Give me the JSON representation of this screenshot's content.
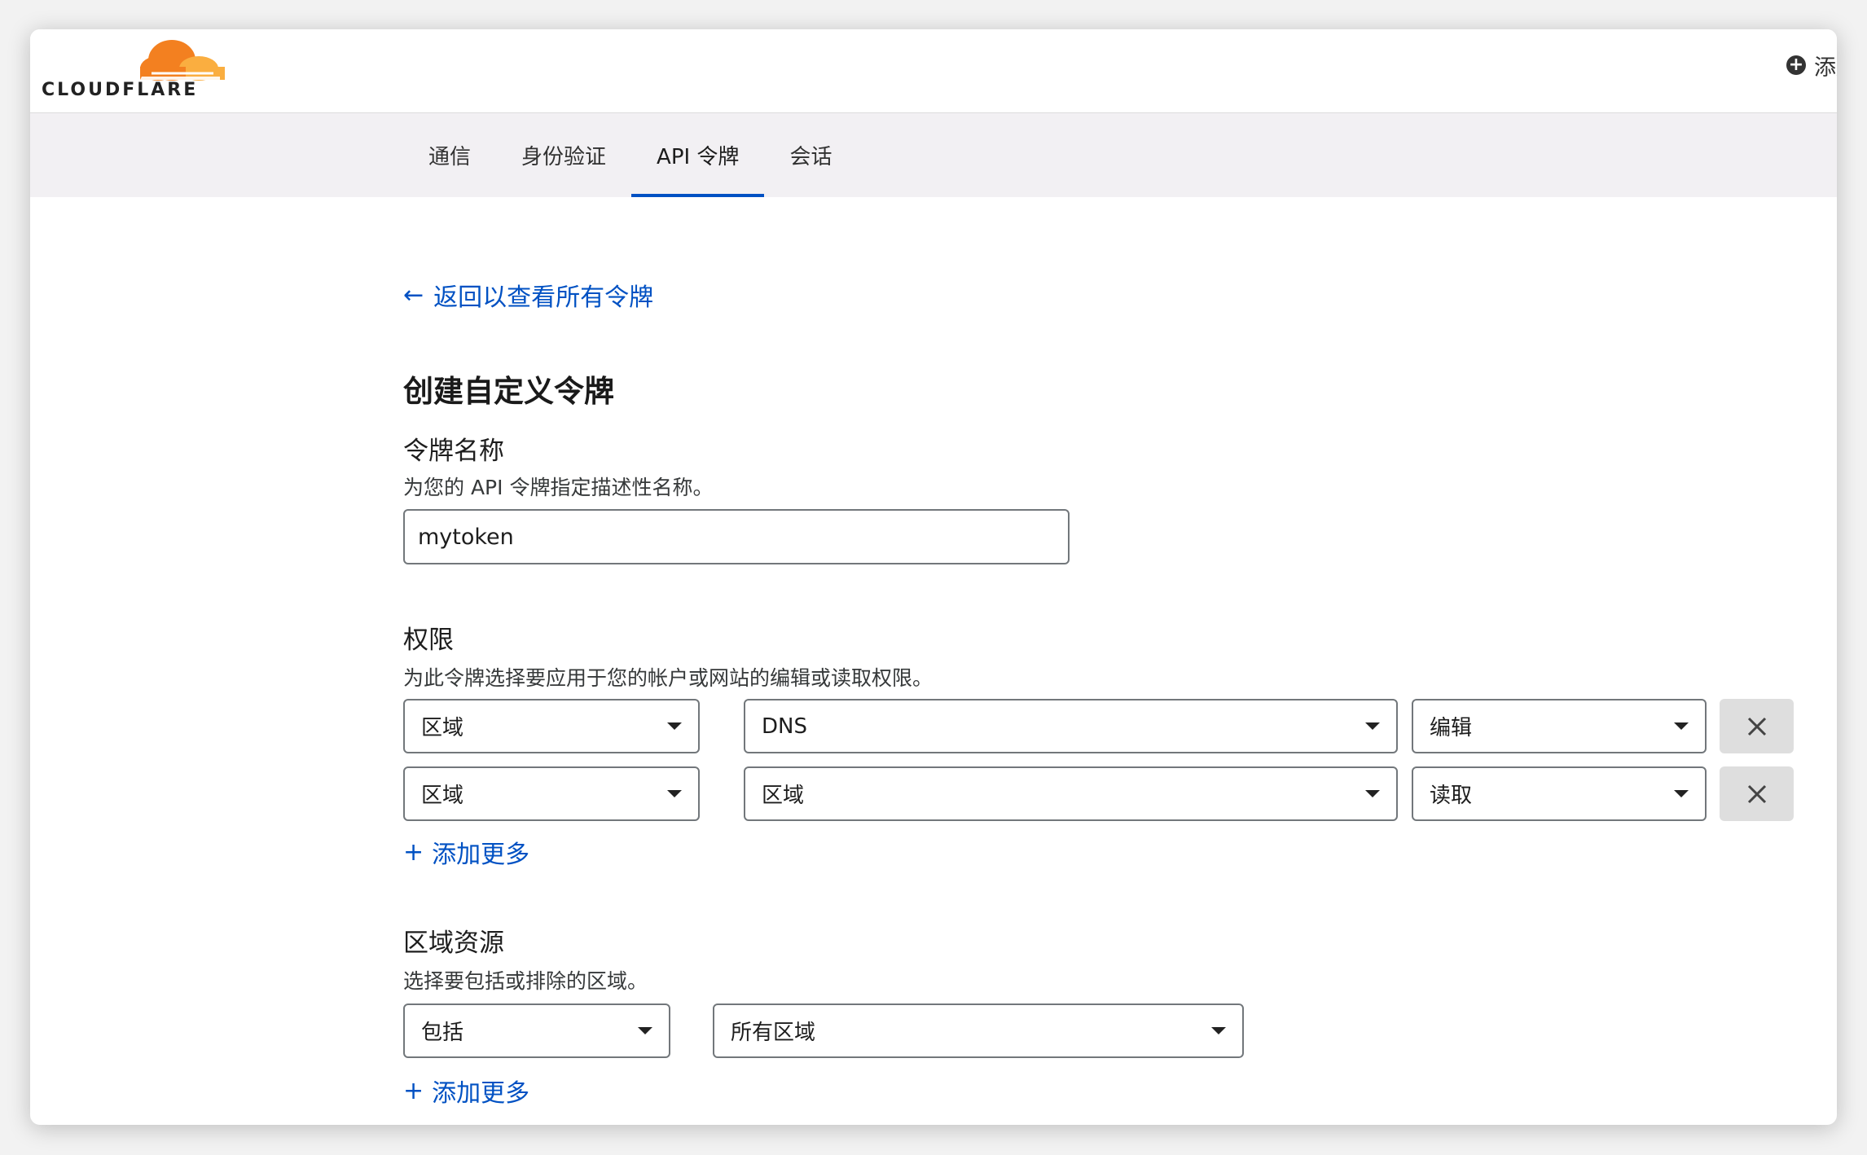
{
  "brand": {
    "logo_text": "CLOUDFLARE",
    "orange": "#f38020",
    "orange_light": "#faae40"
  },
  "header": {
    "add_label": "添加站点",
    "add_icon": "plus-circle-icon"
  },
  "nav": {
    "tabs": [
      {
        "label": "通信",
        "active": false
      },
      {
        "label": "身份验证",
        "active": false
      },
      {
        "label": "API 令牌",
        "active": true
      },
      {
        "label": "会话",
        "active": false
      }
    ],
    "active_color": "#0051c3"
  },
  "page": {
    "back_label": "返回以查看所有令牌",
    "title": "创建自定义令牌",
    "link_color": "#0051c3"
  },
  "token_name": {
    "label": "令牌名称",
    "description": "为您的 API 令牌指定描述性名称。",
    "value": "mytoken"
  },
  "permissions": {
    "label": "权限",
    "description": "为此令牌选择要应用于您的帐户或网站的编辑或读取权限。",
    "rows": [
      {
        "scope": "区域",
        "resource": "DNS",
        "access": "编辑"
      },
      {
        "scope": "区域",
        "resource": "区域",
        "access": "读取"
      }
    ],
    "add_more_label": "添加更多"
  },
  "zone_resources": {
    "label": "区域资源",
    "description": "选择要包括或排除的区域。",
    "include": "包括",
    "zones": "所有区域",
    "add_more_label": "添加更多"
  }
}
